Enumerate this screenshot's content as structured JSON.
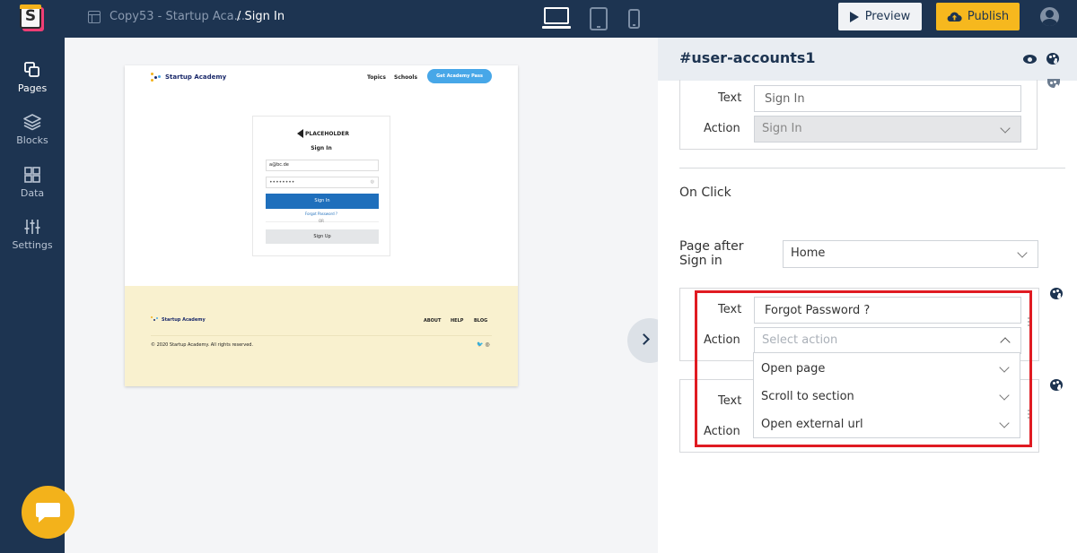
{
  "topbar": {
    "logo_letter": "S",
    "project_name": "Copy53 - Startup Aca...",
    "page_name": "/ Sign In",
    "preview_label": "Preview",
    "publish_label": "Publish"
  },
  "sidebar": {
    "items": [
      {
        "label": "Pages"
      },
      {
        "label": "Blocks"
      },
      {
        "label": "Data"
      },
      {
        "label": "Settings"
      }
    ]
  },
  "canvas": {
    "brand": "Startup Academy",
    "nav_links": [
      "Topics",
      "Schools"
    ],
    "cta": "Get Academy Pass",
    "card": {
      "logo": "PLACEHOLDER",
      "title": "Sign In",
      "email_value": "a@bc.de",
      "password_value": "••••••••",
      "signin_label": "Sign In",
      "forgot_label": "Forgot Password ?",
      "or_label": "OR",
      "signup_label": "Sign Up"
    },
    "footer": {
      "brand": "Startup Academy",
      "links": [
        "ABOUT",
        "HELP",
        "BLOG"
      ],
      "copyright": "© 2020 Startup Academy. All rights reserved.",
      "social": "🐦 ◎"
    }
  },
  "panel": {
    "title": "#user-accounts1",
    "group1": {
      "text_label": "Text",
      "text_value": "Sign In",
      "action_label": "Action",
      "action_value": "Sign In"
    },
    "on_click_label": "On Click",
    "page_after_label": "Page after Sign in",
    "page_after_value": "Home",
    "group2": {
      "text_label": "Text",
      "text_value": "Forgot Password ?",
      "action_label": "Action",
      "action_placeholder": "Select action",
      "options": [
        "Open page",
        "Scroll to section",
        "Open external url"
      ]
    },
    "group3": {
      "text_label": "Text",
      "action_label": "Action"
    }
  },
  "colors": {
    "topbar_bg": "#1d3451",
    "accent_yellow": "#f6b81e",
    "highlight_red": "#e01b22",
    "canvas_cta_blue": "#47a7e8",
    "signin_blue": "#1f6fbc"
  }
}
